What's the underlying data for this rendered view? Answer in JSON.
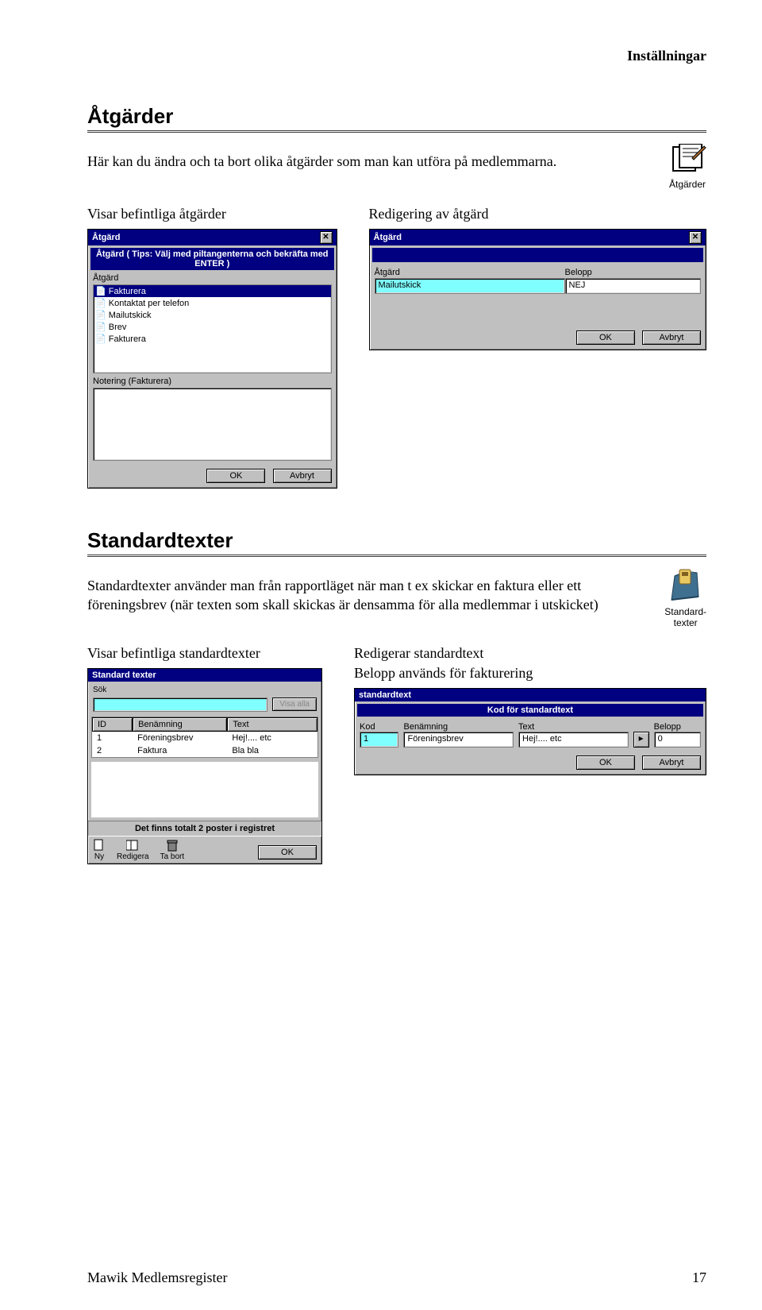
{
  "pageHeader": "Inställningar",
  "section1": {
    "title": "Åtgärder",
    "desc": "Här kan du ändra och ta bort olika åtgärder som man kan utföra på medlemmarna.",
    "capLeft": "Visar befintliga åtgärder",
    "capRight": "Redigering av åtgärd",
    "iconLabel": "Åtgärder"
  },
  "dlg1": {
    "title": "Åtgärd",
    "subtitle": "Åtgärd ( Tips: Välj med piltangenterna och bekräfta med ENTER )",
    "listLabel": "Åtgärd",
    "items": [
      "Fakturera",
      "Kontaktat per telefon",
      "Mailutskick",
      "Brev",
      "Fakturera"
    ],
    "noteLabel": "Notering (Fakturera)",
    "ok": "OK",
    "cancel": "Avbryt"
  },
  "dlg2": {
    "title": "Åtgärd",
    "fldActionLabel": "Åtgärd",
    "fldActionVal": "Mailutskick",
    "fldBeloppLabel": "Belopp",
    "fldBeloppVal": "NEJ",
    "ok": "OK",
    "cancel": "Avbryt"
  },
  "section2": {
    "title": "Standardtexter",
    "desc": "Standardtexter använder man från rapportläget när man t ex skickar en faktura eller ett föreningsbrev (när texten som skall skickas är densamma för alla medlemmar i utskicket)",
    "capLeft": "Visar befintliga standardtexter",
    "capRight1": "Redigerar standardtext",
    "capRight2": "Belopp används för fakturering",
    "iconLabel": "Standard-\ntexter"
  },
  "dlg3": {
    "title": "Standard texter",
    "searchLabel": "Sök",
    "showAll": "Visa alla",
    "headers": [
      "ID",
      "Benämning",
      "Text"
    ],
    "rows": [
      {
        "id": "1",
        "name": "Föreningsbrev",
        "text": "Hej!.... etc"
      },
      {
        "id": "2",
        "name": "Faktura",
        "text": "Bla bla"
      }
    ],
    "status": "Det finns totalt  2 poster i registret",
    "tbNew": "Ny",
    "tbEdit": "Redigera",
    "tbDel": "Ta bort",
    "ok": "OK"
  },
  "dlg4": {
    "title": "standardtext",
    "subtitle": "Kod för standardtext",
    "fKod": "Kod",
    "vKod": "1",
    "fName": "Benämning",
    "vName": "Föreningsbrev",
    "fText": "Text",
    "vText": "Hej!.... etc",
    "fBelopp": "Belopp",
    "vBelopp": "0",
    "memoBtn": "▸",
    "ok": "OK",
    "cancel": "Avbryt"
  },
  "footer": {
    "left": "Mawik Medlemsregister",
    "right": "17"
  }
}
